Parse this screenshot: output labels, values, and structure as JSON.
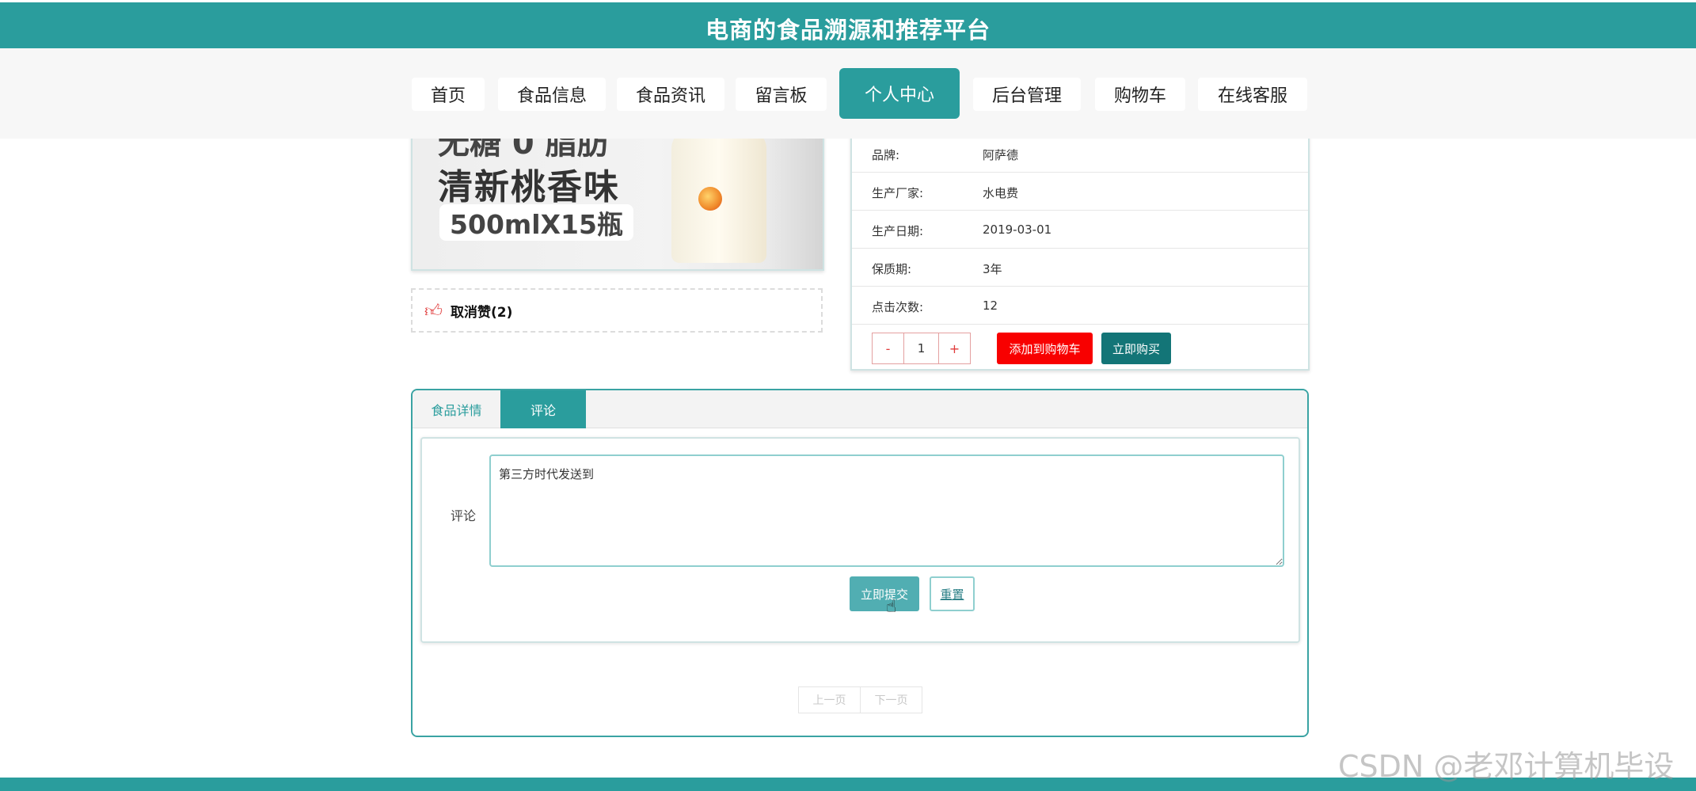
{
  "site": {
    "title": "电商的食品溯源和推荐平台"
  },
  "nav": {
    "items": [
      {
        "label": "首页"
      },
      {
        "label": "食品信息"
      },
      {
        "label": "食品资讯"
      },
      {
        "label": "留言板"
      },
      {
        "label": "个人中心",
        "active": true
      },
      {
        "label": "后台管理"
      },
      {
        "label": "购物车"
      },
      {
        "label": "在线客服"
      }
    ]
  },
  "product": {
    "image_text": {
      "line1": "无糖 0 脂肪",
      "line2": "清新桃香味",
      "line3": "500mlX15瓶"
    },
    "like_label": "取消赞(2)",
    "info": [
      {
        "key": "品牌:",
        "value": "阿萨德"
      },
      {
        "key": "生产厂家:",
        "value": "水电费"
      },
      {
        "key": "生产日期:",
        "value": "2019-03-01"
      },
      {
        "key": "保质期:",
        "value": "3年"
      },
      {
        "key": "点击次数:",
        "value": "12"
      }
    ],
    "quantity": {
      "minus": "-",
      "value": "1",
      "plus": "+"
    },
    "add_to_cart_label": "添加到购物车",
    "buy_now_label": "立即购买"
  },
  "tabs": [
    {
      "label": "食品详情"
    },
    {
      "label": "评论",
      "active": true
    }
  ],
  "comment_form": {
    "label": "评论",
    "value": "第三方时代发送到",
    "submit_label": "立即提交",
    "reset_label": "重置"
  },
  "pager": {
    "prev": "上一页",
    "next": "下一页"
  },
  "watermark": "CSDN @老邓计算机毕设",
  "colors": {
    "primary": "#2a9d9d",
    "cart_button": "#f80000",
    "buy_button": "#137577",
    "submit_button": "#51aeb2"
  }
}
